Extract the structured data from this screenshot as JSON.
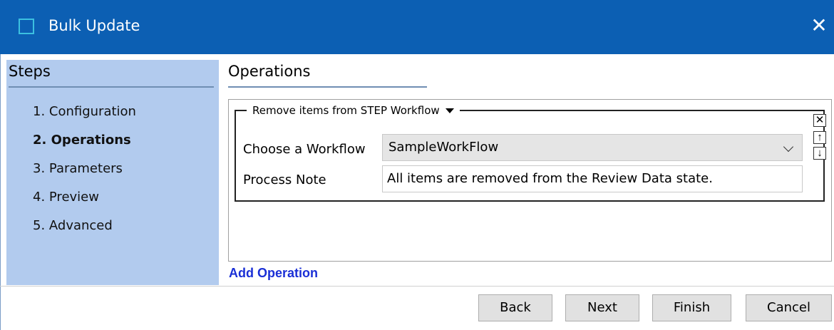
{
  "window": {
    "title": "Bulk Update",
    "close_glyph": "✕",
    "accent_color": "#0c5fb3"
  },
  "sidebar": {
    "title": "Steps",
    "items": [
      {
        "label": "1. Configuration",
        "active": false
      },
      {
        "label": "2. Operations",
        "active": true
      },
      {
        "label": "3. Parameters",
        "active": false
      },
      {
        "label": "4. Preview",
        "active": false
      },
      {
        "label": "5. Advanced",
        "active": false
      }
    ]
  },
  "main": {
    "title": "Operations",
    "operation": {
      "type_label": "Remove items from STEP Workflow",
      "controls": {
        "remove": "✕",
        "up": "↑",
        "down": "↓"
      },
      "fields": {
        "workflow_label": "Choose a Workflow",
        "workflow_value": "SampleWorkFlow",
        "note_label": "Process Note",
        "note_value": "All items are removed from the Review Data state."
      }
    },
    "add_operation_label": "Add Operation"
  },
  "footer": {
    "back_label": "Back",
    "next_label": "Next",
    "finish_label": "Finish",
    "cancel_label": "Cancel"
  }
}
